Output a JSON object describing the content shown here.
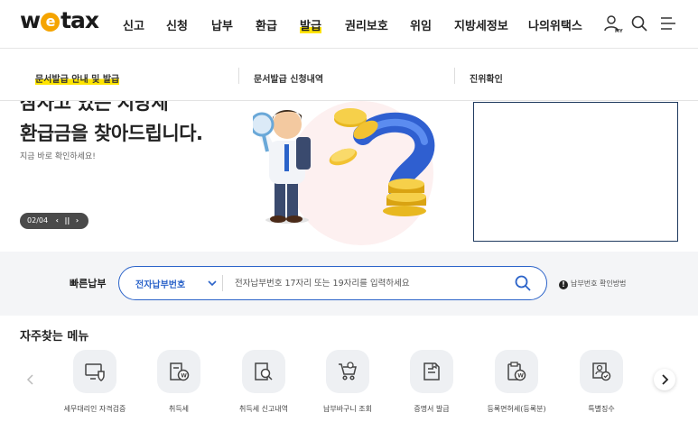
{
  "header": {
    "logo": {
      "pre": "w",
      "mid": "e",
      "post": "tax"
    },
    "nav": [
      "신고",
      "신청",
      "납부",
      "환급",
      "발급",
      "권리보호",
      "위임",
      "지방세정보",
      "나의위택스"
    ],
    "active_nav": "발급"
  },
  "submenu": {
    "items": [
      "문서발급 안내 및 발급",
      "문서발급 신청내역",
      "진위확인"
    ]
  },
  "hero": {
    "title_line1": "잠자고 있는 지방세",
    "title_line2": "환급금을 찾아드립니다.",
    "subtitle": "지금 바로 확인하세요!",
    "pager": {
      "current": "02",
      "total": "04",
      "separator": "/"
    }
  },
  "quick_pay": {
    "label": "빠른납부",
    "select_value": "전자납부번호",
    "placeholder": "전자납부번호 17자리 또는 19자리를 입력하세요",
    "help_text": "납부번호 확인방법"
  },
  "favorites": {
    "title": "자주찾는 메뉴",
    "items": [
      {
        "label": "세무대리인 자격검증",
        "icon": "monitor-shield-icon"
      },
      {
        "label": "취득세",
        "icon": "building-won-icon"
      },
      {
        "label": "취득세 신고내역",
        "icon": "document-search-icon"
      },
      {
        "label": "납부바구니 조회",
        "icon": "cart-icon"
      },
      {
        "label": "증명서 발급",
        "icon": "certificate-icon"
      },
      {
        "label": "등록면허세(등록분)",
        "icon": "clipboard-won-icon"
      },
      {
        "label": "특별징수",
        "icon": "person-check-icon"
      }
    ]
  },
  "colors": {
    "accent_blue": "#2b63c9",
    "highlight_yellow": "#ffe400",
    "logo_orange": "#f5a400",
    "ad_border": "#1f3a5f"
  }
}
